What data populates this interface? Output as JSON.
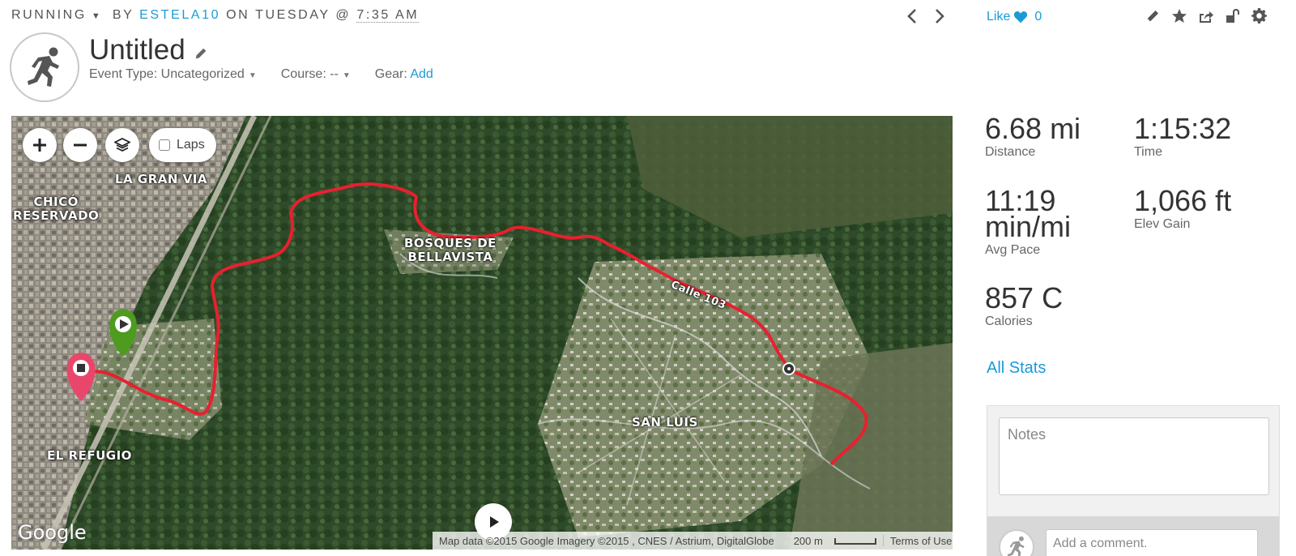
{
  "header": {
    "activity_type": "RUNNING",
    "by": "BY",
    "user": "ESTELA10",
    "on_day": "ON TUESDAY @",
    "time": "7:35 AM"
  },
  "like": {
    "label": "Like",
    "count": "0"
  },
  "activity": {
    "title": "Untitled",
    "event_type": "Event Type: Uncategorized",
    "course": "Course: --",
    "gear_label": "Gear:",
    "gear_action": "Add"
  },
  "map": {
    "laps_label": "Laps",
    "labels": [
      "LA GRAN VIA",
      "CHICÓ\nRESERVADO",
      "BOSQUES DE\nBELLAVISTA",
      "SAN LUIS",
      "EL REFUGIO"
    ],
    "street_label": "Calle 103",
    "logo": "Google",
    "attribution": "Map data ©2015 Google Imagery ©2015 , CNES / Astrium, DigitalGlobe",
    "scale": "200 m",
    "terms": "Terms of Use",
    "route_color": "#e8202f",
    "start_marker_color": "#4d9b1f",
    "end_marker_color": "#e8476b"
  },
  "stats": {
    "distance": {
      "value": "6.68 mi",
      "label": "Distance"
    },
    "time": {
      "value": "1:15:32",
      "label": "Time"
    },
    "pace_value_1": "11:19",
    "pace_value_2": "min/mi",
    "pace_label": "Avg Pace",
    "elev": {
      "value": "1,066 ft",
      "label": "Elev Gain"
    },
    "calories": {
      "value": "857 C",
      "label": "Calories"
    },
    "all_stats": "All Stats"
  },
  "notes": {
    "placeholder": "Notes"
  },
  "comment": {
    "placeholder": "Add a comment."
  },
  "icons": [
    "chevron-left-icon",
    "chevron-right-icon",
    "heart-icon",
    "pencil-icon",
    "star-icon",
    "share-icon",
    "unlock-icon",
    "gear-icon",
    "runner-icon",
    "zoom-in-icon",
    "zoom-out-icon",
    "layers-icon",
    "play-icon"
  ],
  "colors": {
    "accent": "#1a9bd7"
  }
}
